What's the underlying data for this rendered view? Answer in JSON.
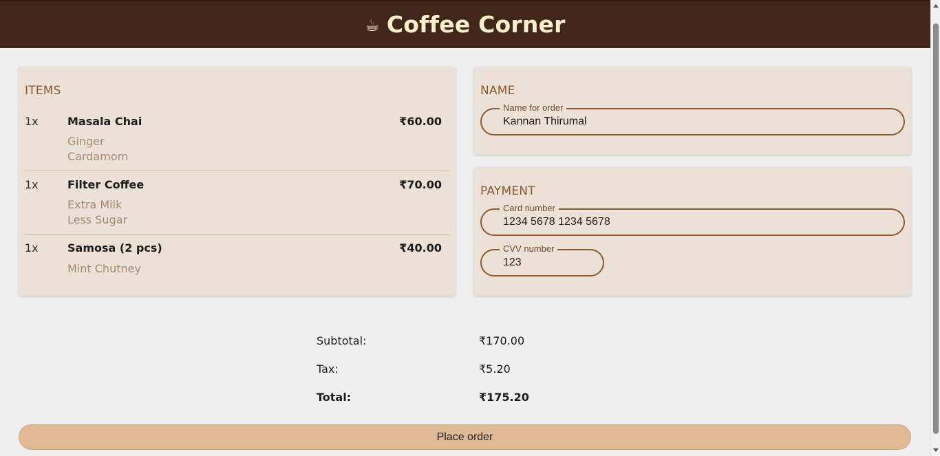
{
  "header": {
    "logo_icon": "☕︎",
    "title": "Coffee Corner"
  },
  "items_section": {
    "label": "ITEMS",
    "items": [
      {
        "qty": "1x",
        "name": "Masala Chai",
        "price": "₹60.00",
        "options": [
          "Ginger",
          "Cardamom"
        ]
      },
      {
        "qty": "1x",
        "name": "Filter Coffee",
        "price": "₹70.00",
        "options": [
          "Extra Milk",
          "Less Sugar"
        ]
      },
      {
        "qty": "1x",
        "name": "Samosa (2 pcs)",
        "price": "₹40.00",
        "options": [
          "Mint Chutney"
        ]
      }
    ]
  },
  "name_section": {
    "label": "NAME",
    "field_label": "Name for order",
    "field_value": "Kannan Thirumal"
  },
  "payment_section": {
    "label": "PAYMENT",
    "card_label": "Card number",
    "card_value": "1234 5678 1234 5678",
    "cvv_label": "CVV number",
    "cvv_value": "123"
  },
  "totals": {
    "subtotal_label": "Subtotal:",
    "subtotal_value": "₹170.00",
    "tax_label": "Tax:",
    "tax_value": "₹5.20",
    "total_label": "Total:",
    "total_value": "₹175.20"
  },
  "order_button": {
    "label": "Place order"
  },
  "colors": {
    "header_bg": "#41271b",
    "title": "#fbf0cc",
    "card_bg": "#ece1d6",
    "accent": "#8a5a30",
    "button_bg": "#e0b995"
  }
}
